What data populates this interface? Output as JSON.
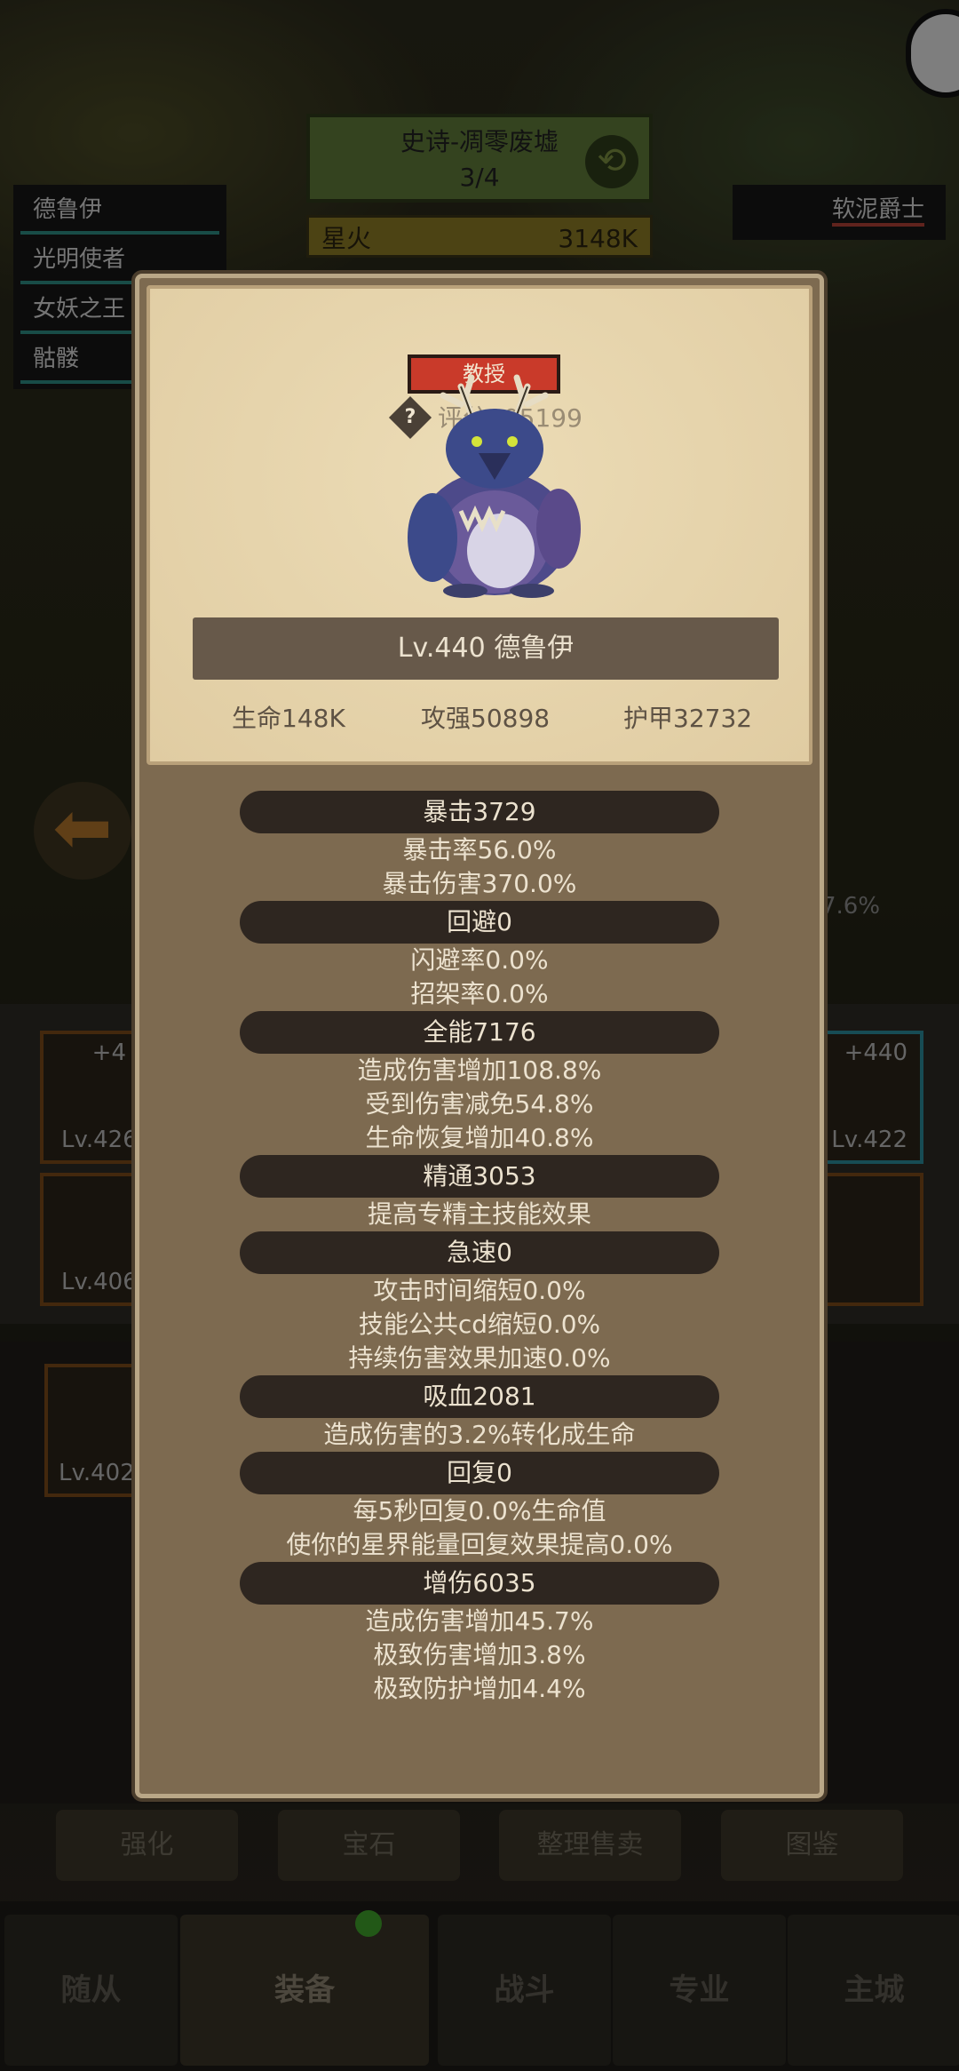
{
  "background": {
    "stage_name": "史诗-凋零废墟",
    "stage_progress": "3/4",
    "boss_label": "星火",
    "boss_value": "3148K",
    "party": [
      "德鲁伊",
      "光明使者",
      "女妖之王",
      "骷髅"
    ],
    "enemy": "软泥爵士",
    "percent_text": "7.6%",
    "slots": [
      {
        "level": "Lv.426",
        "plus": "+4"
      },
      {
        "level": "Lv.406",
        "plus": ""
      },
      {
        "level": "Lv.422",
        "plus": "+440"
      },
      {
        "level": "Lv.402",
        "plus": ""
      }
    ],
    "bottom_buttons": [
      "强化",
      "宝石",
      "整理售卖",
      "图鉴"
    ],
    "tabs": [
      "随从",
      "装备",
      "战斗",
      "专业",
      "主城"
    ],
    "active_tab": "装备"
  },
  "modal": {
    "rank_badge": "教授",
    "help_icon": "?",
    "score_text": "评分105199",
    "name_line": "Lv.440 德鲁伊",
    "stats": {
      "hp": "生命148K",
      "attack": "攻强50898",
      "armor": "护甲32732"
    },
    "sections": [
      {
        "head": "暴击3729",
        "lines": [
          "暴击率56.0%",
          "暴击伤害370.0%"
        ]
      },
      {
        "head": "回避0",
        "lines": [
          "闪避率0.0%",
          "招架率0.0%"
        ]
      },
      {
        "head": "全能7176",
        "lines": [
          "造成伤害增加108.8%",
          "受到伤害减免54.8%",
          "生命恢复增加40.8%"
        ]
      },
      {
        "head": "精通3053",
        "lines": [
          "提高专精主技能效果"
        ]
      },
      {
        "head": "急速0",
        "lines": [
          "攻击时间缩短0.0%",
          "技能公共cd缩短0.0%",
          "持续伤害效果加速0.0%"
        ]
      },
      {
        "head": "吸血2081",
        "lines": [
          "造成伤害的3.2%转化成生命"
        ]
      },
      {
        "head": "回复0",
        "lines": [
          "每5秒回复0.0%生命值",
          "使你的星界能量回复效果提高0.0%"
        ]
      },
      {
        "head": "增伤6035",
        "lines": [
          "造成伤害增加45.7%",
          "极致伤害增加3.8%",
          "极致防护增加4.4%"
        ]
      }
    ]
  }
}
